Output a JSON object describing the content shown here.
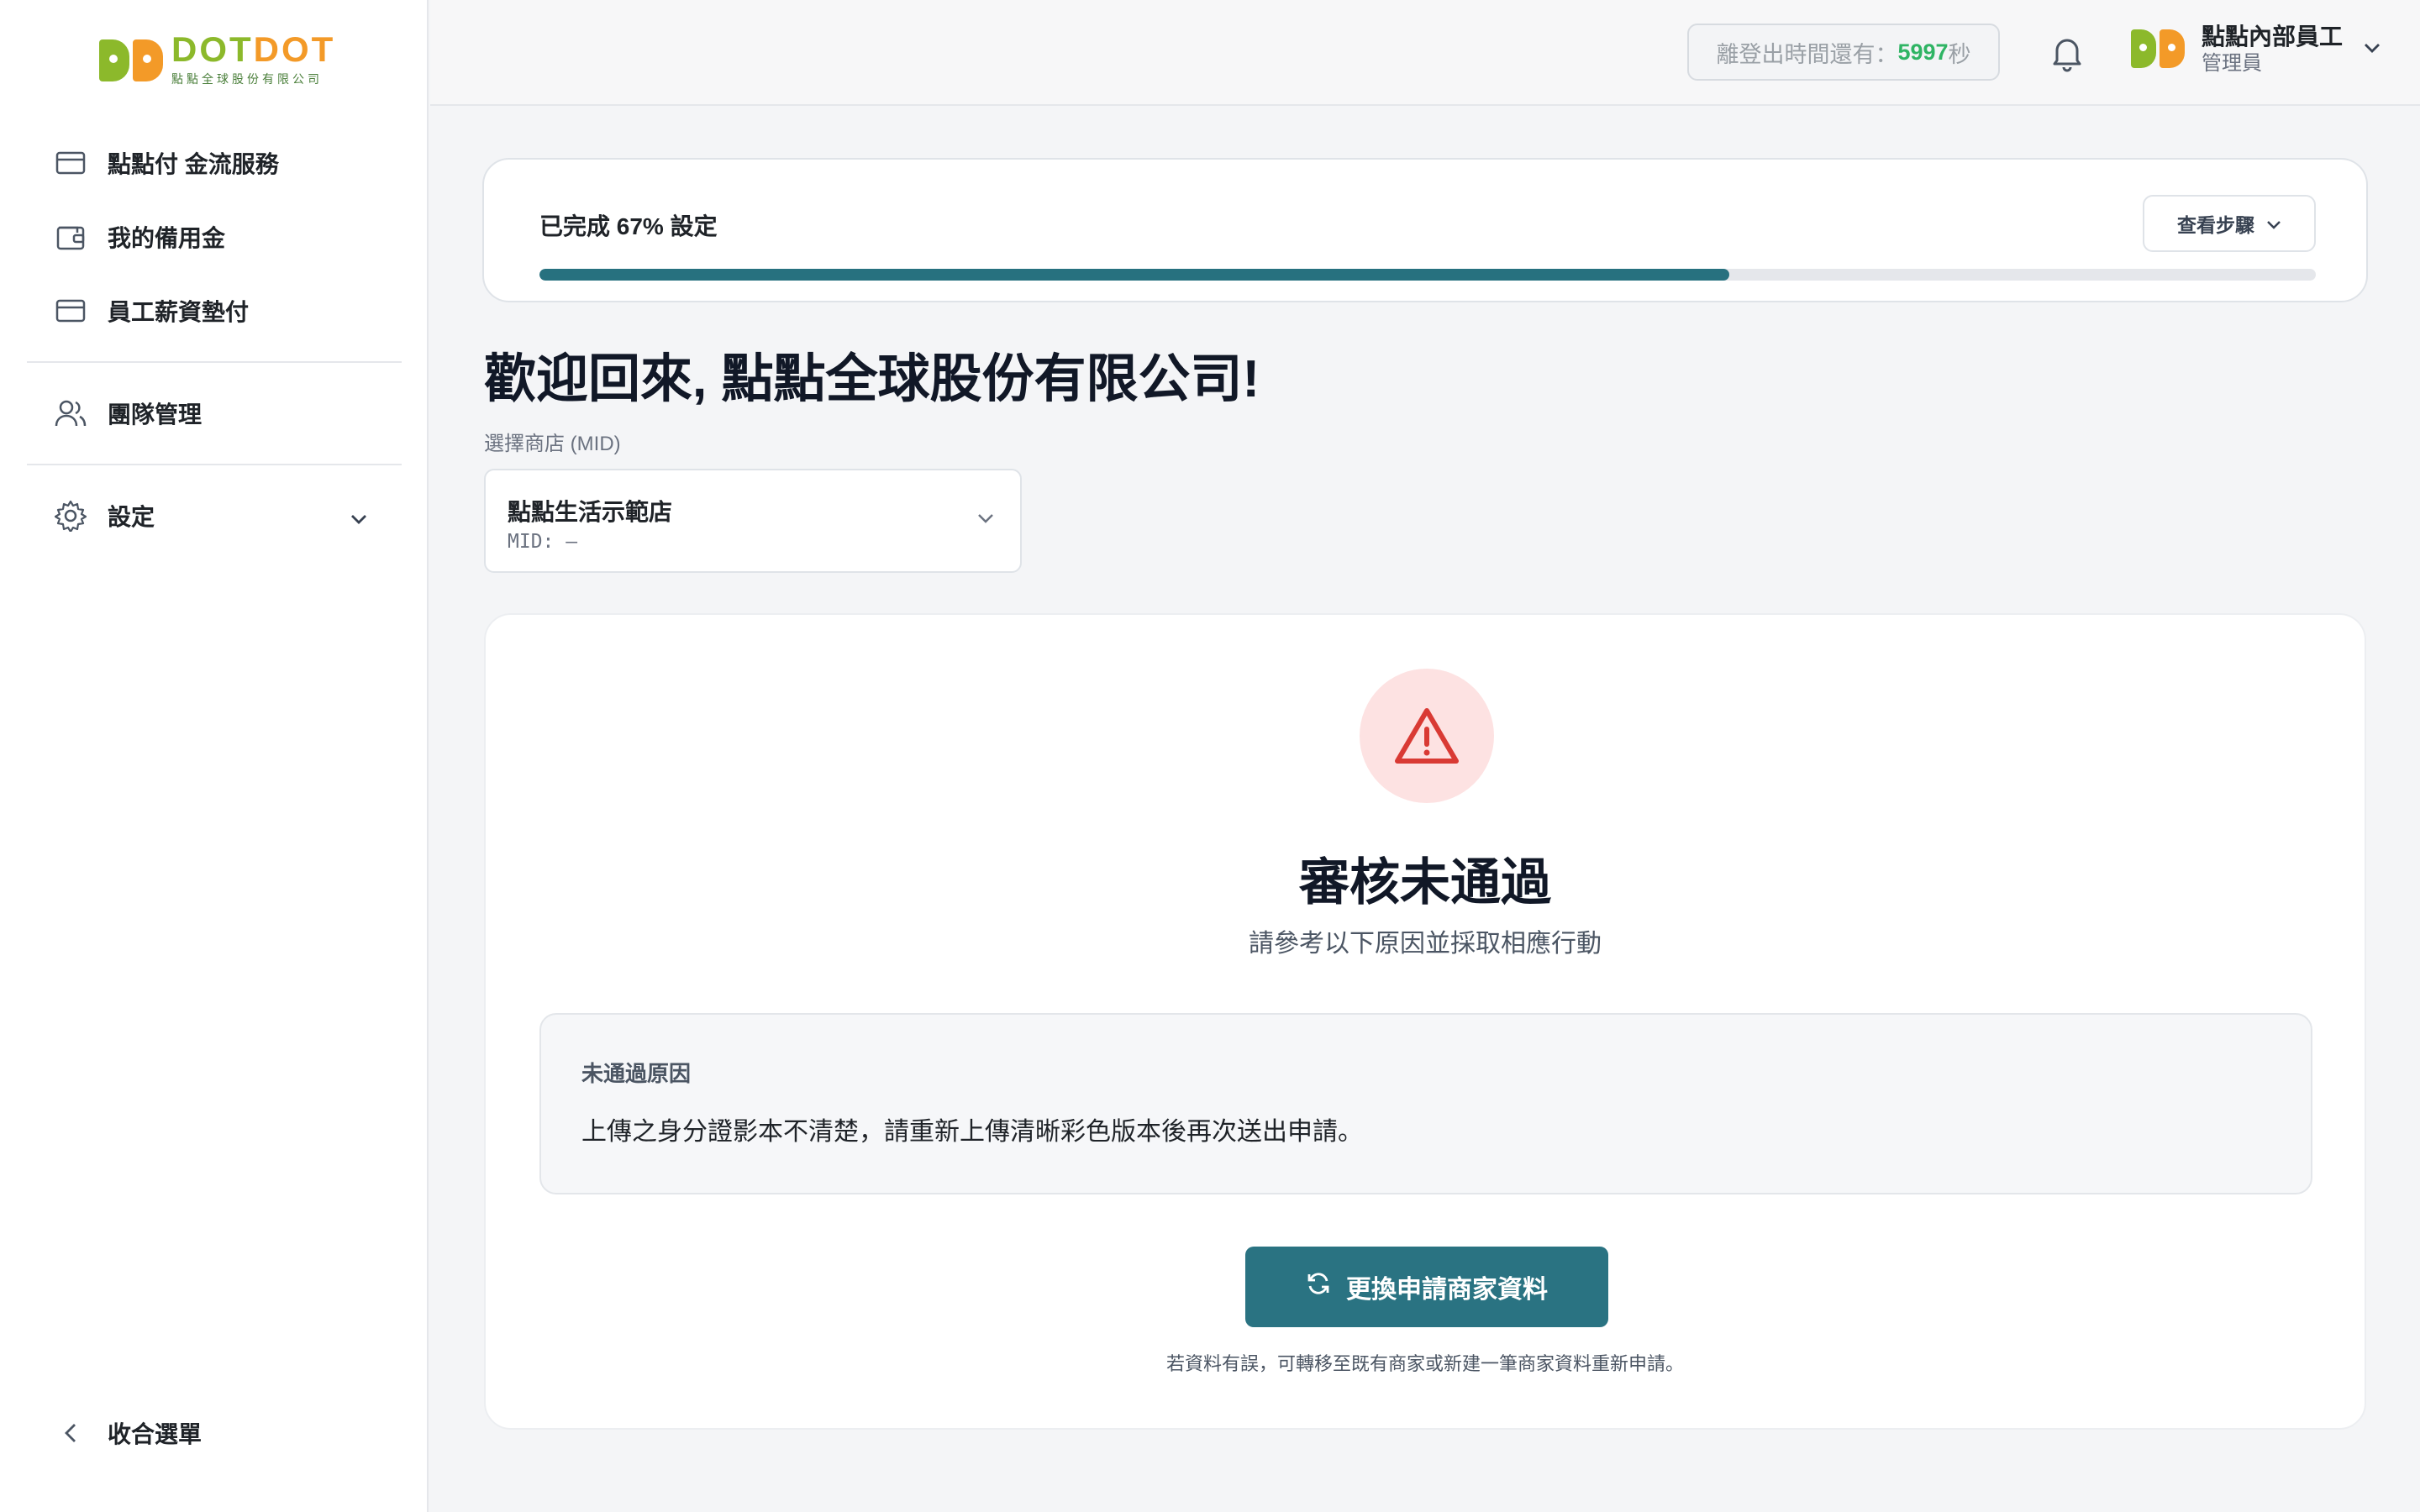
{
  "brand": {
    "name_part1": "DOT",
    "name_part2": "DOT",
    "subtitle": "點點全球股份有限公司"
  },
  "sidebar": {
    "items": [
      {
        "label": "點點付 金流服務",
        "icon": "credit-card-icon"
      },
      {
        "label": "我的備用金",
        "icon": "wallet-icon"
      },
      {
        "label": "員工薪資墊付",
        "icon": "credit-card-icon"
      },
      {
        "label": "團隊管理",
        "icon": "users-icon"
      },
      {
        "label": "設定",
        "icon": "gear-icon"
      }
    ],
    "collapse_label": "收合選單"
  },
  "topbar": {
    "timer_prefix": "離登出時間還有：",
    "timer_value": "5997",
    "timer_suffix": "秒",
    "user_name": "點點內部員工",
    "user_role": "管理員"
  },
  "progress": {
    "label": "已完成 67% 設定",
    "percent": 67,
    "steps_button": "查看步驟"
  },
  "welcome": "歡迎回來, 點點全球股份有限公司!",
  "store_select": {
    "label": "選擇商店 (MID)",
    "store_name": "點點生活示範店",
    "mid": "MID: –"
  },
  "review": {
    "title": "審核未通過",
    "subtitle": "請參考以下原因並採取相應行動",
    "reason_title": "未通過原因",
    "reason_text": "上傳之身分證影本不清楚，請重新上傳清晰彩色版本後再次送出申請。",
    "action_button": "更換申請商家資料",
    "hint": "若資料有誤，可轉移至既有商家或新建一筆商家資料重新申請。"
  },
  "colors": {
    "accent": "#27717f",
    "brand_green": "#8cb92b",
    "brand_orange": "#f39a28",
    "timer_green": "#2fb464",
    "warning_red": "#d93a34",
    "warning_bg": "#fde2e2"
  }
}
